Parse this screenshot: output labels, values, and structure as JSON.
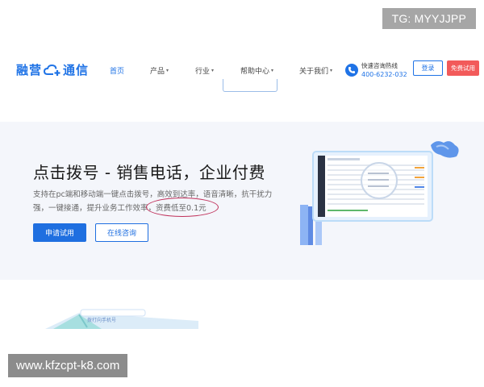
{
  "overlay": {
    "tag": "TG: MYYJJPP",
    "site": "www.kfzcpt-k8.com"
  },
  "header": {
    "logo": {
      "left": "融营",
      "right": "通信"
    },
    "nav": [
      {
        "label": "首页",
        "caret": ""
      },
      {
        "label": "产品",
        "caret": "▾"
      },
      {
        "label": "行业",
        "caret": "▾"
      },
      {
        "label": "帮助中心",
        "caret": "▾"
      },
      {
        "label": "关于我们",
        "caret": "▾"
      }
    ],
    "hotline": {
      "label": "快速咨询热线",
      "number": "400-6232-032"
    },
    "login_label": "登录",
    "trial_label": "免费试用"
  },
  "hero": {
    "title": "点击拨号 - 销售电话，企业付费",
    "desc_line1": "支持在pc端和移动端一键点击拨号，高效到达率，语音清晰，抗干扰力",
    "desc_line2_a": "强，一键接通，提升业务工作效率，",
    "desc_line2_b": "资费低至0.1元",
    "btn_apply": "申请试用",
    "btn_consult": "在线咨询"
  },
  "bottom": {
    "caption": "拨打向手机号"
  },
  "colors": {
    "brand": "#1f73e6",
    "trial": "#f25a5a",
    "hero_bg": "#f4f6fb",
    "highlight": "#c0305a"
  }
}
